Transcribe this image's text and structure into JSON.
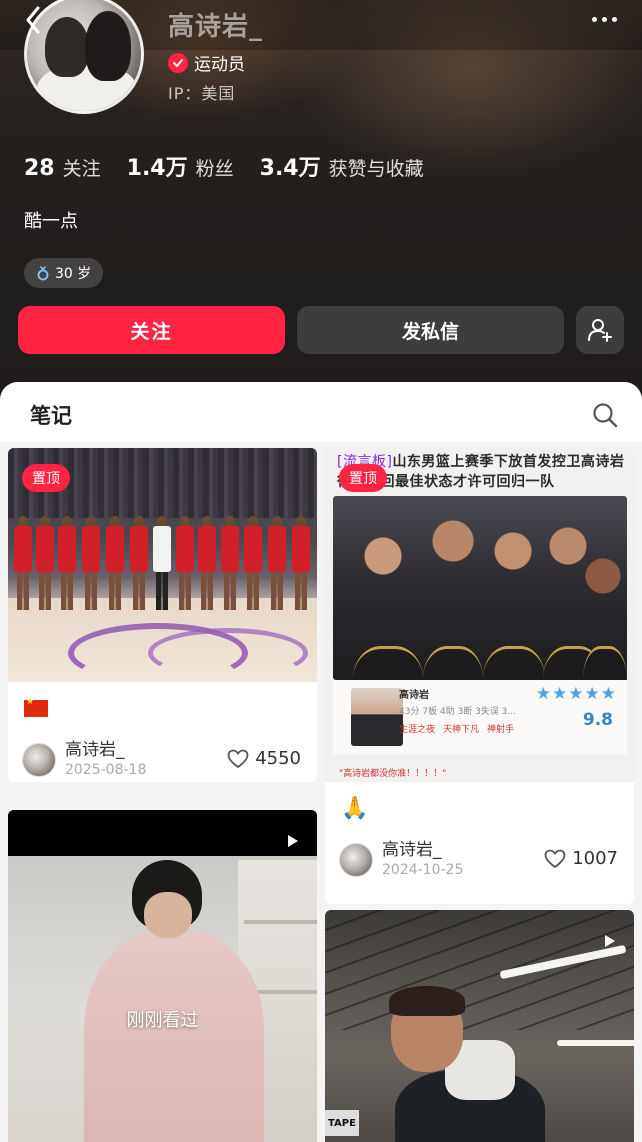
{
  "profile": {
    "username": "高诗岩_",
    "badge_label": "运动员",
    "ip_label": "IP：美国",
    "bio": "酷一点",
    "age_tag": "30 岁",
    "stats": [
      {
        "value": "28",
        "label": "关注"
      },
      {
        "value": "1.4万",
        "label": "粉丝"
      },
      {
        "value": "3.4万",
        "label": "获赞与收藏"
      }
    ],
    "icons": {
      "back": "back-arrow-icon",
      "more": "more-dots-icon",
      "gender": "male-icon",
      "verified": "verified-check-icon"
    }
  },
  "actions": {
    "follow_label": "关注",
    "message_label": "发私信",
    "add_friend_icon": "add-friend-icon"
  },
  "notes_panel": {
    "title": "笔记",
    "search_icon": "search-icon"
  },
  "cards": [
    {
      "pin_label": "置顶",
      "caption_icon": "china-flag",
      "author": "高诗岩_",
      "date": "2025-08-18",
      "likes": "4550"
    },
    {
      "pin_label": "置顶",
      "headline_bracket": "[流言板]",
      "headline": "山东男篮上赛季下放首发控卫高诗岩待其找回最佳状态才许可回归一队",
      "player_name": "高诗岩",
      "player_line": "43分 7板 4助 3断 3失误 3...",
      "player_tags": [
        "生涯之夜",
        "天神下凡",
        "神射手"
      ],
      "rating": "9.8",
      "stars": "★★★★★",
      "footnote": "\"高诗岩都没你准！！！！\"",
      "caption": "🙏",
      "author": "高诗岩_",
      "date": "2024-10-25",
      "likes": "1007"
    },
    {
      "overlay_label": "刚刚看过",
      "type_icon": "video-play-icon"
    },
    {
      "type_icon": "video-play-icon",
      "sign_text": "TAPE"
    }
  ],
  "colors": {
    "accent": "#ff2442",
    "header_bg": "#221f1d",
    "panel_bg": "#f4f4f4"
  }
}
